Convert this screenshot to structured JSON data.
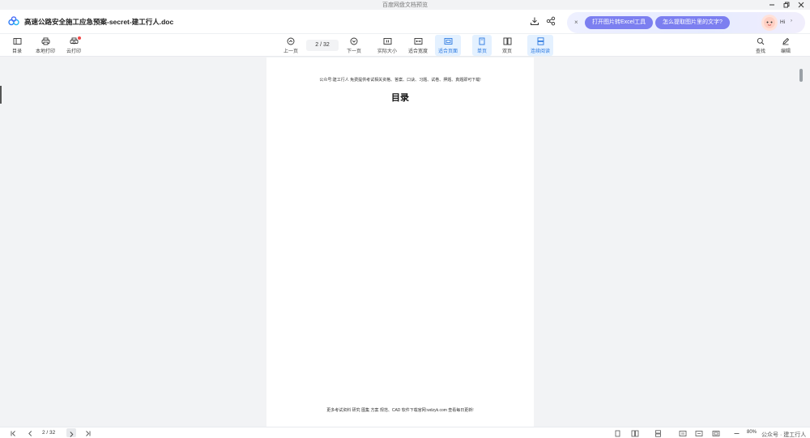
{
  "window": {
    "title": "百度网盘文档预览"
  },
  "header": {
    "doc_title": "高速公路安全施工应急预案-secret-建工行人.doc",
    "promo": {
      "close": "×",
      "pill1": "打开图片转Excel工具",
      "pill2": "怎么提取图片里的文字?",
      "greeting": "Hi",
      "caret": "›"
    }
  },
  "toolbar": {
    "contents": "目录",
    "local_print": "本地打印",
    "cloud_print": "云打印",
    "prev_page": "上一页",
    "page_indicator": "2 / 32",
    "next_page": "下一页",
    "actual_size": "实际大小",
    "fit_width": "适合宽度",
    "fit_page": "适合页面",
    "single_page": "单页",
    "double_page": "双页",
    "continuous": "连续阅读",
    "find": "查找",
    "edit": "编辑"
  },
  "page": {
    "header_text": "公众号:建工行人 免费提供考试相关资格、答案、口诀、习题、试卷、押题、真题即可下载!",
    "heading": "目录",
    "footer_text": "更多考试资料 研究 图集 方案 规范、CAD 软件下载官网:wdzyk.com 查看每日更新!"
  },
  "statusbar": {
    "page_indicator": "2 / 32",
    "zoom": "80%"
  },
  "watermark": "公众号 · 建工行人"
}
